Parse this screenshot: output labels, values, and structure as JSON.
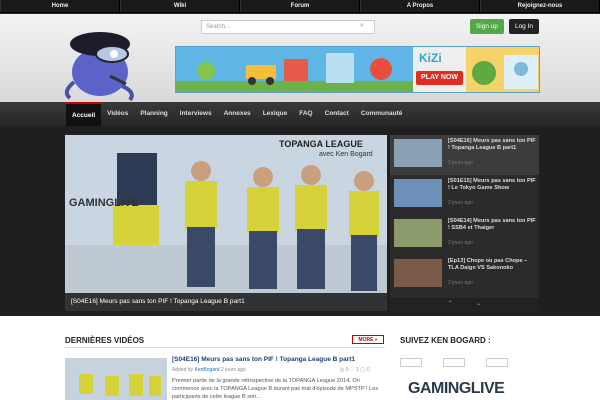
{
  "topnav": [
    "Home",
    "Wiki",
    "Forum",
    "A Propos",
    "Rejoignez-nous"
  ],
  "search": {
    "placeholder": "Search..."
  },
  "auth": {
    "signup": "Sign up",
    "login": "Log In"
  },
  "ad": {
    "brand": "KiZi",
    "cta": "PLAY NOW"
  },
  "mainnav": [
    "Accueil",
    "Vidéos",
    "Planning",
    "Interviews",
    "Annexes",
    "Lexique",
    "FAQ",
    "Contact",
    "Communauté"
  ],
  "slider": {
    "caption": "[S04E16] Meurs pas sans ton PIF ! Topanga League B part1",
    "title_line1": "TOPANGA LEAGUE",
    "title_line2": "avec Ken Bogard",
    "watermark": "GAMINGLIVE"
  },
  "side": [
    {
      "title": "[S04E16] Meurs pas sans ton PIF ! Topanga League B part1",
      "time": "2 jours ago"
    },
    {
      "title": "[S01E15] Meurs pas sans ton PIF ! Le Tokyo Game Show",
      "time": "2 jours ago"
    },
    {
      "title": "[S04E14] Meurs pas sans ton PIF ! SSB4 et Thaiger",
      "time": "2 jours ago"
    },
    {
      "title": "[Ep13] Chope ou pas Chope – TLA Daigo VS Sakonoko",
      "time": "2 jours ago"
    }
  ],
  "latest": {
    "heading": "DERNIÈRES VIDÉOS",
    "more": "MORE »",
    "title": "[S04E16] Meurs pas sans ton PIF ! Topanga League B part1",
    "added_by": "Added by",
    "author": "KenBogard",
    "time": "2 jours ago",
    "stats": "◎ 0   ♡ 1   ◯ 0",
    "desc": "Premier partie de la grande rétrospective de la TOPANGA League 2014. On commence avec la TOPANGA League B durant pas mal d'épisode de MPSTP ! Les participants de cette league B son..."
  },
  "follow": {
    "heading": "SUIVEZ KEN BOGARD :",
    "logo": "GAMINGLIVE"
  }
}
